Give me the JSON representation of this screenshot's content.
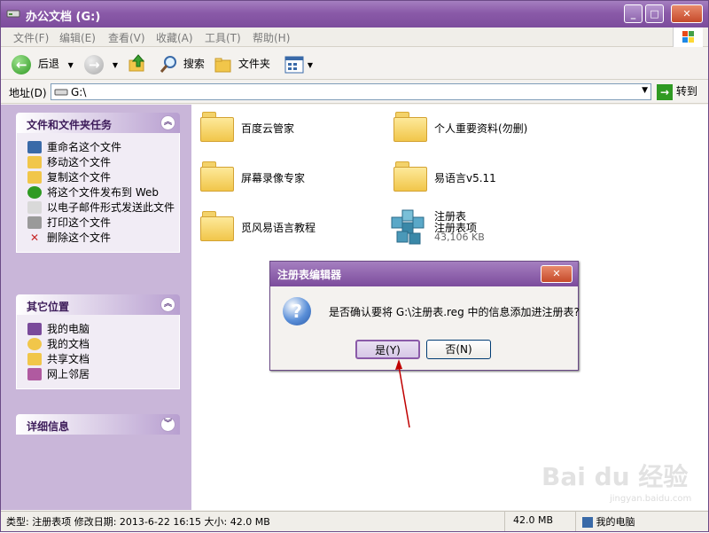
{
  "window": {
    "title": "办公文档 (G:)",
    "min": "_",
    "max": "□",
    "close": "✕"
  },
  "menu": [
    "文件(F)",
    "编辑(E)",
    "查看(V)",
    "收藏(A)",
    "工具(T)",
    "帮助(H)"
  ],
  "toolbar": {
    "back": "后退",
    "search": "搜索",
    "folders": "文件夹"
  },
  "address": {
    "label": "地址(D)",
    "value": "G:\\",
    "go": "转到"
  },
  "panels": {
    "tasks": {
      "title": "文件和文件夹任务",
      "items": [
        "重命名这个文件",
        "移动这个文件",
        "复制这个文件",
        "将这个文件发布到 Web",
        "以电子邮件形式发送此文件",
        "打印这个文件",
        "删除这个文件"
      ]
    },
    "places": {
      "title": "其它位置",
      "items": [
        "我的电脑",
        "我的文档",
        "共享文档",
        "网上邻居"
      ]
    },
    "details": {
      "title": "详细信息"
    }
  },
  "files": [
    {
      "name": "百度云管家"
    },
    {
      "name": "个人重要资料(勿删)"
    },
    {
      "name": "屏幕录像专家"
    },
    {
      "name": "易语言v5.11"
    },
    {
      "name": "觅风易语言教程"
    },
    {
      "name": "注册表",
      "type": "注册表项",
      "size": "43,106 KB"
    }
  ],
  "dialog": {
    "title": "注册表编辑器",
    "message": "是否确认要将 G:\\注册表.reg 中的信息添加进注册表?",
    "yes": "是(Y)",
    "no": "否(N)"
  },
  "status": {
    "info": "类型: 注册表项 修改日期: 2013-6-22 16:15 大小: 42.0 MB",
    "size": "42.0 MB",
    "location": "我的电脑"
  },
  "watermark": {
    "main": "Bai du 经验",
    "sub": "jingyan.baidu.com"
  },
  "colors": {
    "titlebar": "#8a5aa8",
    "leftpane": "#c9b6d9",
    "folder": "#f1c64a",
    "arrow": "#c00000"
  }
}
